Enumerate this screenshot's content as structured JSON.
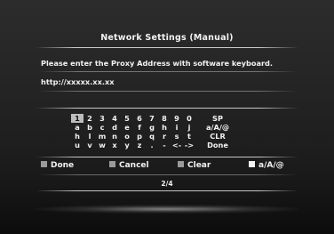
{
  "dialog": {
    "title": "Network Settings (Manual)",
    "instruction": "Please  enter the  Proxy  Address  with software keyboard.",
    "input_value": "http://xxxxx.xx.xx",
    "page_indicator": "2/4"
  },
  "keyboard": {
    "selected_key": "1",
    "rows": [
      [
        "1",
        "2",
        "3",
        "4",
        "5",
        "6",
        "7",
        "8",
        "9",
        "0",
        "SP"
      ],
      [
        "a",
        "b",
        "c",
        "d",
        "e",
        "f",
        "g",
        "h",
        "i",
        "j",
        "a/A/@"
      ],
      [
        "h",
        "l",
        "m",
        "n",
        "o",
        "p",
        "q",
        "r",
        "s",
        "t",
        "CLR"
      ],
      [
        "u",
        "v",
        "w",
        "x",
        "y",
        "z",
        ".",
        "-",
        "<-",
        "->",
        "Done"
      ]
    ]
  },
  "legend": {
    "done_label": "Done",
    "cancel_label": "Cancel",
    "clear_label": "Clear",
    "mode_label": "a/A/@"
  },
  "colors": {
    "background": "#242424",
    "text": "#f2f2f2",
    "key_highlight": "#bdbdbd",
    "swatch_gray": "#9a9a9a",
    "swatch_white": "#f5f5f5"
  }
}
